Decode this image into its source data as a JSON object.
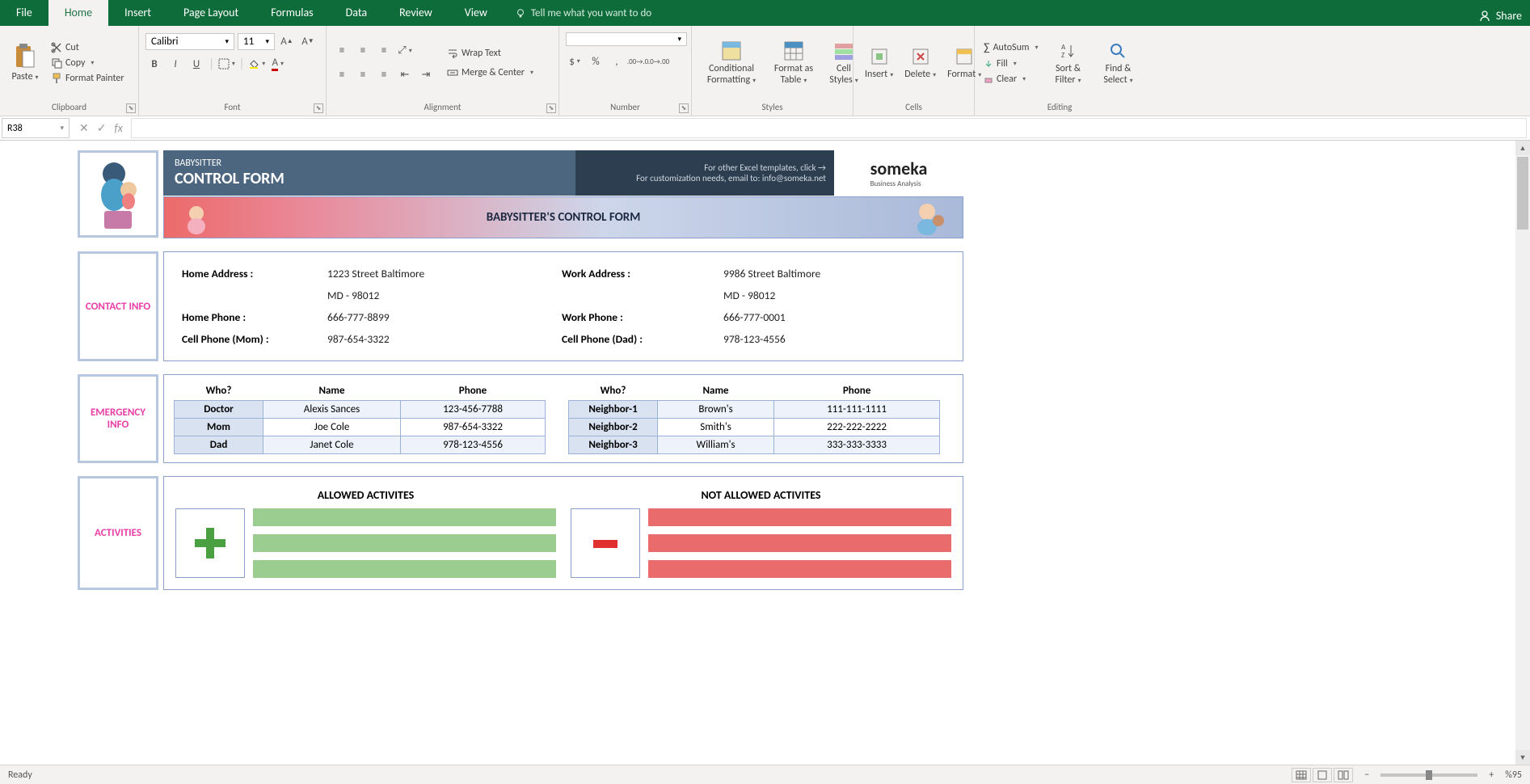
{
  "titlebar": {
    "share_label": "Share"
  },
  "tabs": {
    "file": "File",
    "home": "Home",
    "insert": "Insert",
    "page_layout": "Page Layout",
    "formulas": "Formulas",
    "data": "Data",
    "review": "Review",
    "view": "View",
    "tellme": "Tell me what you want to do"
  },
  "ribbon": {
    "clipboard": {
      "label": "Clipboard",
      "paste": "Paste",
      "cut": "Cut",
      "copy": "Copy",
      "format_painter": "Format Painter"
    },
    "font": {
      "label": "Font",
      "name": "Calibri",
      "size": "11"
    },
    "alignment": {
      "label": "Alignment",
      "wrap": "Wrap Text",
      "merge": "Merge & Center"
    },
    "number": {
      "label": "Number",
      "format": ""
    },
    "styles": {
      "label": "Styles",
      "cond": "Conditional Formatting",
      "fat": "Format as Table",
      "cell": "Cell Styles"
    },
    "cells": {
      "label": "Cells",
      "insert": "Insert",
      "delete": "Delete",
      "format": "Format"
    },
    "editing": {
      "label": "Editing",
      "autosum": "AutoSum",
      "fill": "Fill",
      "clear": "Clear",
      "sort": "Sort & Filter",
      "find": "Find & Select"
    }
  },
  "namebox": "R38",
  "doc": {
    "header": {
      "subtitle": "BABYSITTER",
      "title": "CONTROL FORM",
      "info1": "For other Excel templates, click →",
      "info2": "For customization needs, email to: info@someka.net",
      "brand": "someka",
      "brand_sub": "Business Analysis",
      "banner": "BABYSITTER'S CONTROL FORM"
    },
    "contact": {
      "label": "CONTACT INFO",
      "home_addr_l": "Home Address :",
      "home_addr_v1": "1223 Street Baltimore",
      "home_addr_v2": "MD - 98012",
      "home_phone_l": "Home Phone :",
      "home_phone_v": "666-777-8899",
      "cell_mom_l": "Cell Phone (Mom) :",
      "cell_mom_v": "987-654-3322",
      "work_addr_l": "Work Address :",
      "work_addr_v1": "9986 Street Baltimore",
      "work_addr_v2": "MD - 98012",
      "work_phone_l": "Work Phone :",
      "work_phone_v": "666-777-0001",
      "cell_dad_l": "Cell Phone (Dad) :",
      "cell_dad_v": "978-123-4556"
    },
    "emergency": {
      "label": "EMERGENCY INFO",
      "hdr_who": "Who?",
      "hdr_name": "Name",
      "hdr_phone": "Phone",
      "left": [
        {
          "who": "Doctor",
          "name": "Alexis Sances",
          "phone": "123-456-7788"
        },
        {
          "who": "Mom",
          "name": "Joe Cole",
          "phone": "987-654-3322"
        },
        {
          "who": "Dad",
          "name": "Janet Cole",
          "phone": "978-123-4556"
        }
      ],
      "right": [
        {
          "who": "Neighbor-1",
          "name": "Brown's",
          "phone": "111-111-1111"
        },
        {
          "who": "Neighbor-2",
          "name": "Smith's",
          "phone": "222-222-2222"
        },
        {
          "who": "Neighbor-3",
          "name": "William's",
          "phone": "333-333-3333"
        }
      ]
    },
    "activities": {
      "label": "ACTIVITIES",
      "allowed": "ALLOWED ACTIVITES",
      "not_allowed": "NOT ALLOWED ACTIVITES"
    }
  },
  "status": {
    "ready": "Ready",
    "zoom": "%95"
  }
}
